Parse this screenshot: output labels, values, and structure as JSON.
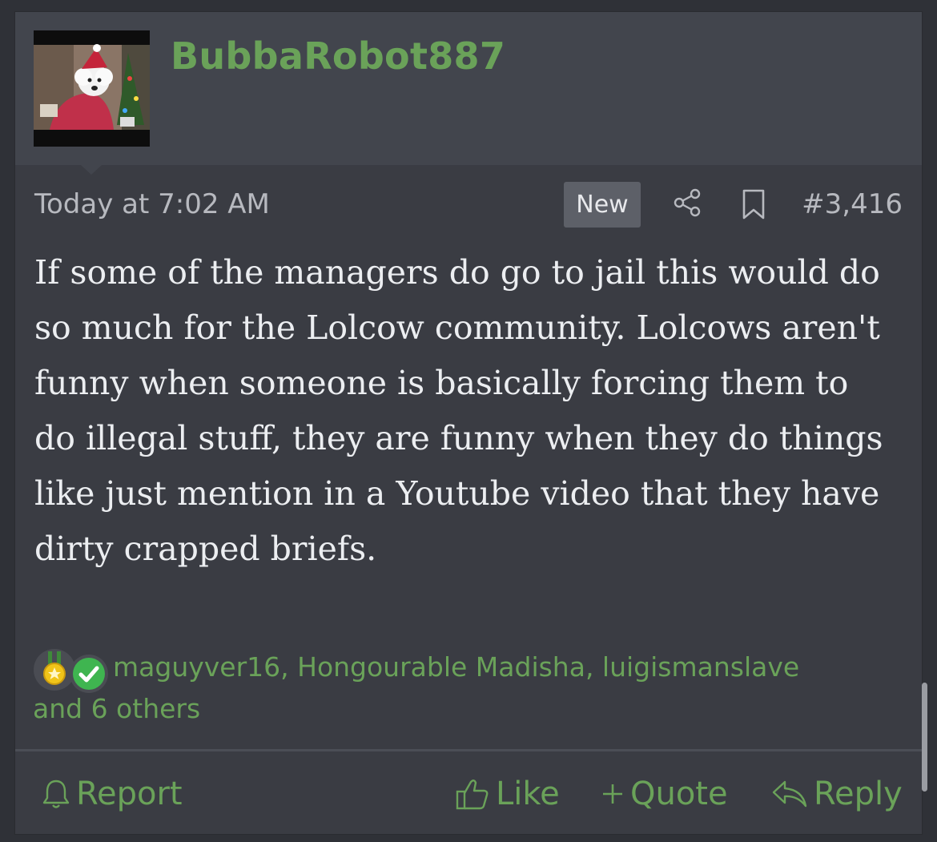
{
  "post": {
    "username": "BubbaRobot887",
    "timestamp": "Today at 7:02 AM",
    "badge": "New",
    "number": "#3,416",
    "body": "If some of the managers do go to jail this would do so much for the Lolcow community. Lolcows aren't funny when someone is basically forcing them to do illegal stuff, they are funny when they do things like just mention in a Youtube video that they have dirty crapped briefs."
  },
  "reactions": {
    "users": "maguyver16, Hongourable Madisha, luigismanslave",
    "others": "and 6 others",
    "icons": [
      "medal-icon",
      "checkmark-icon"
    ]
  },
  "actions": {
    "report": "Report",
    "like": "Like",
    "quote": "Quote",
    "reply": "Reply"
  },
  "colors": {
    "accent": "#6aa259",
    "background": "#3a3c43",
    "header": "#42454d",
    "text": "#eceef1",
    "muted": "#b7b9bf"
  }
}
